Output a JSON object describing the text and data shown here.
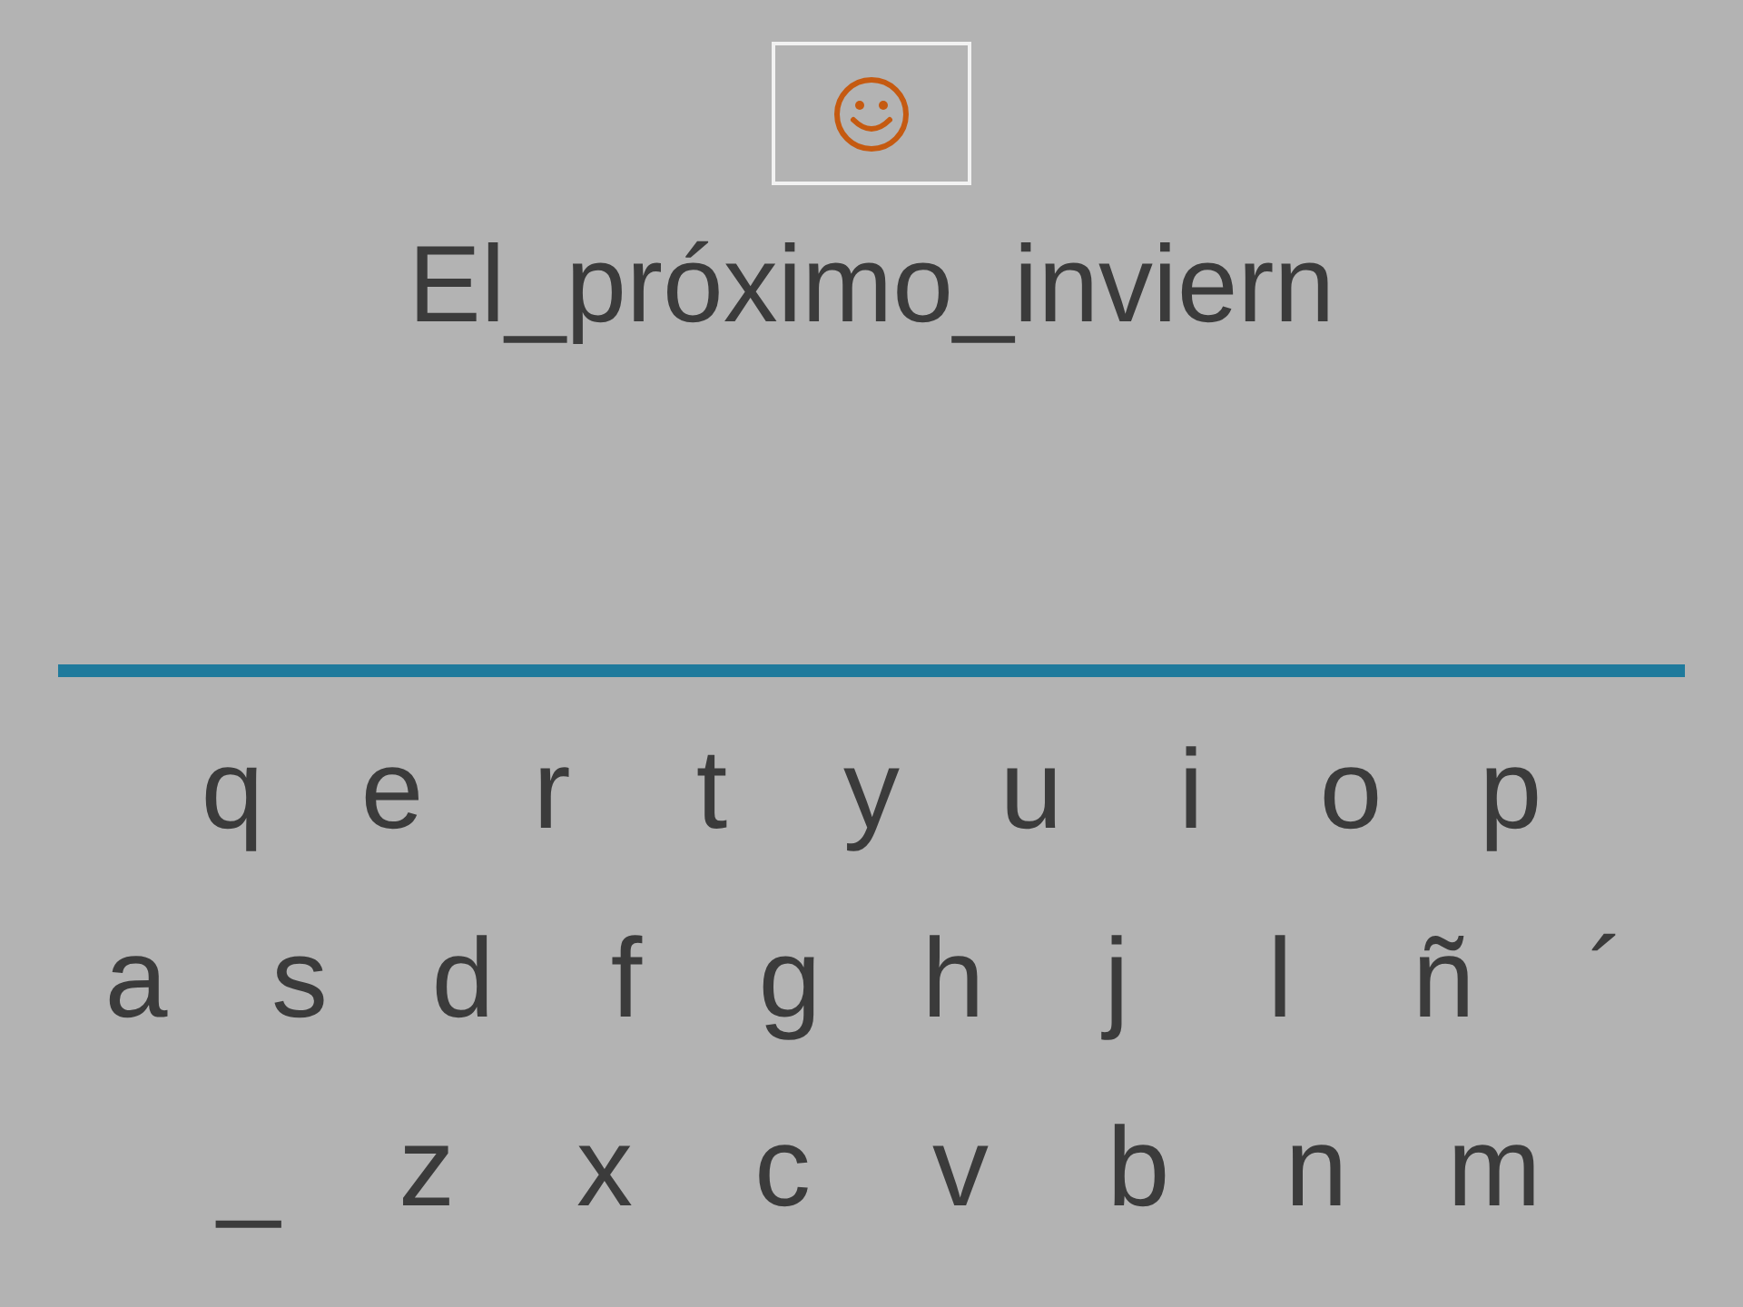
{
  "title": "El_próximo_inviern",
  "keyboard": {
    "rows": [
      [
        "q",
        "e",
        "r",
        "t",
        "y",
        "u",
        "i",
        "o",
        "p"
      ],
      [
        "a",
        "s",
        "d",
        "f",
        "g",
        "h",
        "j",
        "l",
        "ñ",
        "´"
      ],
      [
        "_",
        "z",
        "x",
        "c",
        "v",
        "b",
        "n",
        "m"
      ]
    ]
  }
}
